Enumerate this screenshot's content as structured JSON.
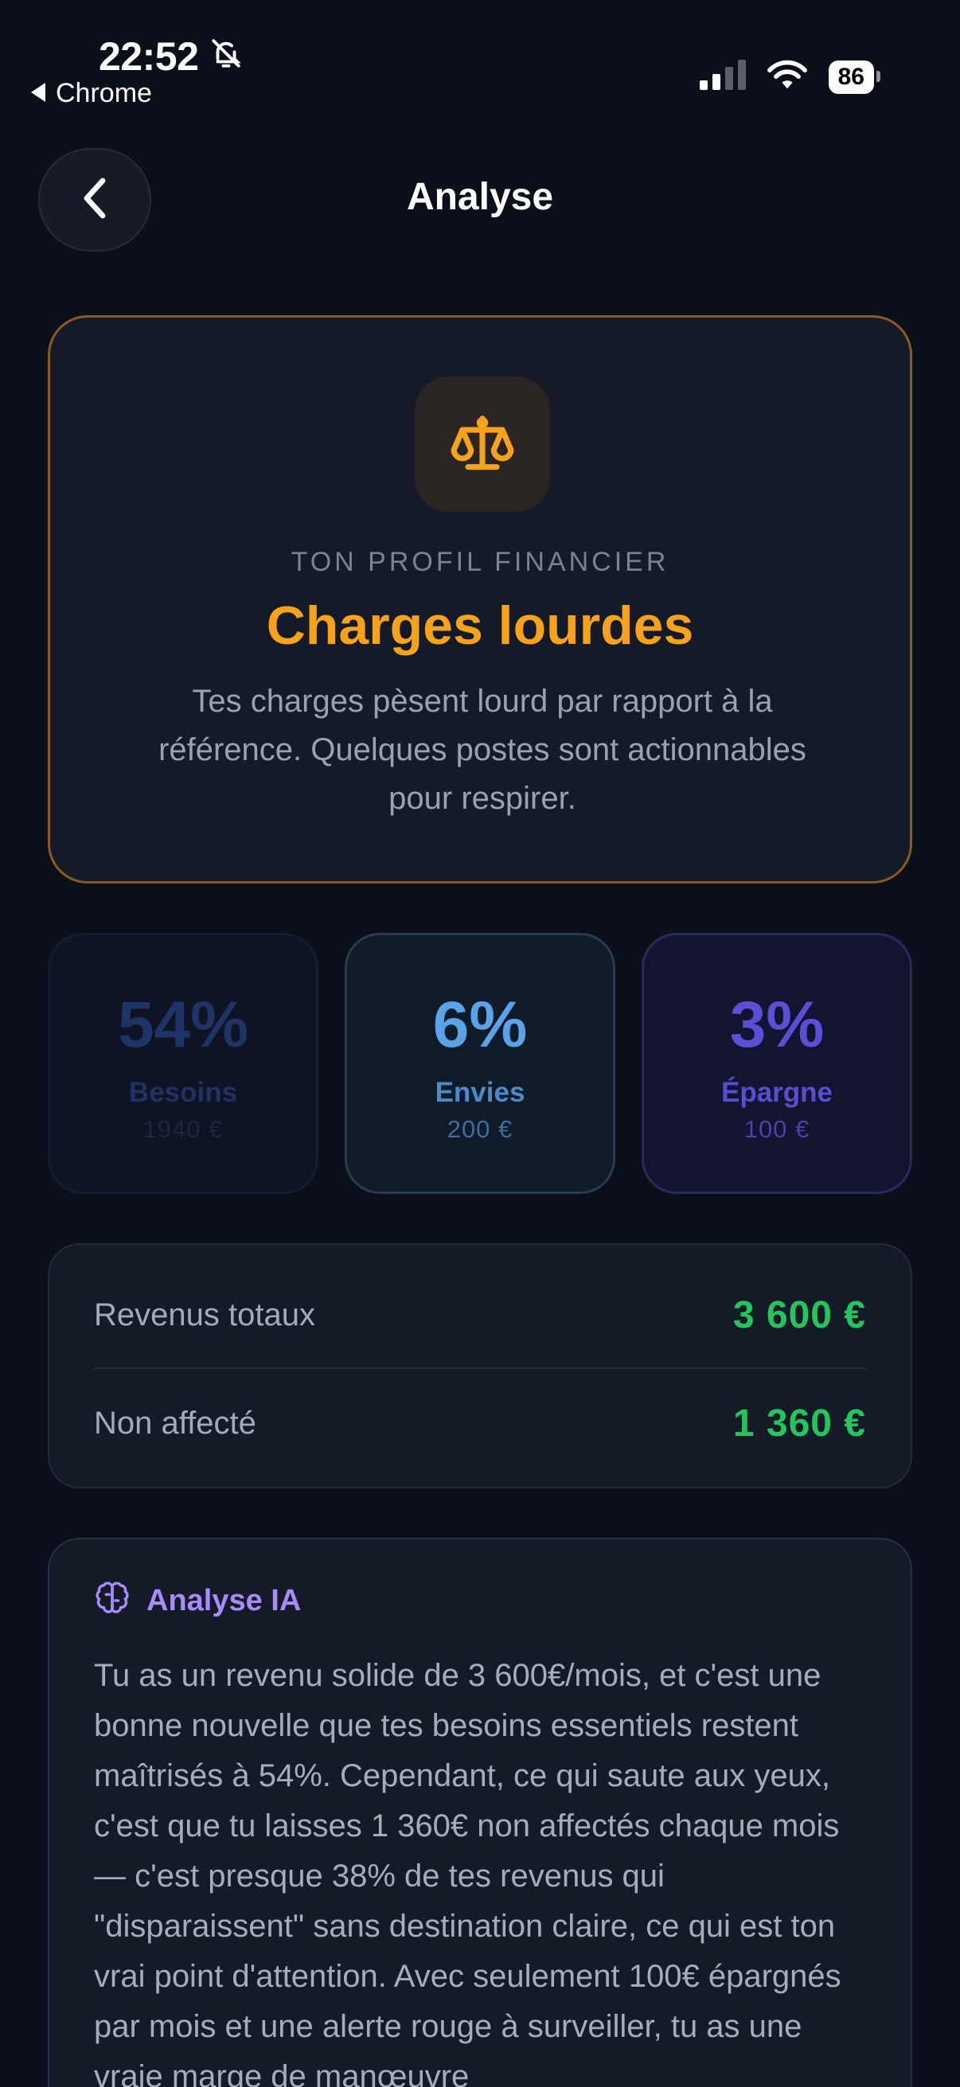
{
  "status_bar": {
    "time": "22:52",
    "back_app": "Chrome",
    "battery": "86"
  },
  "header": {
    "title": "Analyse"
  },
  "profile": {
    "kicker": "TON PROFIL FINANCIER",
    "title": "Charges lourdes",
    "description": "Tes charges pèsent lourd par rapport à la référence. Quelques postes sont actionnables pour respirer.",
    "icon": "scale-icon",
    "accent": "#f6a21a"
  },
  "stats": [
    {
      "percent": "54%",
      "label": "Besoins",
      "amount": "1940 €",
      "color": "#1e3366"
    },
    {
      "percent": "6%",
      "label": "Envies",
      "amount": "200 €",
      "color": "#5aa3e8"
    },
    {
      "percent": "3%",
      "label": "Épargne",
      "amount": "100 €",
      "color": "#5b4fd6"
    }
  ],
  "totals": {
    "revenus_label": "Revenus totaux",
    "revenus_value": "3 600 €",
    "non_affecte_label": "Non affecté",
    "non_affecte_value": "1 360 €",
    "value_color": "#22c55e"
  },
  "ai": {
    "title": "Analyse IA",
    "icon": "brain-icon",
    "text": "Tu as un revenu solide de 3 600€/mois, et c'est une bonne nouvelle que tes besoins essentiels restent maîtrisés à 54%. Cependant, ce qui saute aux yeux, c'est que tu laisses 1 360€ non affectés chaque mois — c'est presque 38% de tes revenus qui \"disparaissent\" sans destination claire, ce qui est ton vrai point d'attention. Avec seulement 100€ épargnés par mois et une alerte rouge à surveiller, tu as une vraie marge de manœuvre"
  }
}
